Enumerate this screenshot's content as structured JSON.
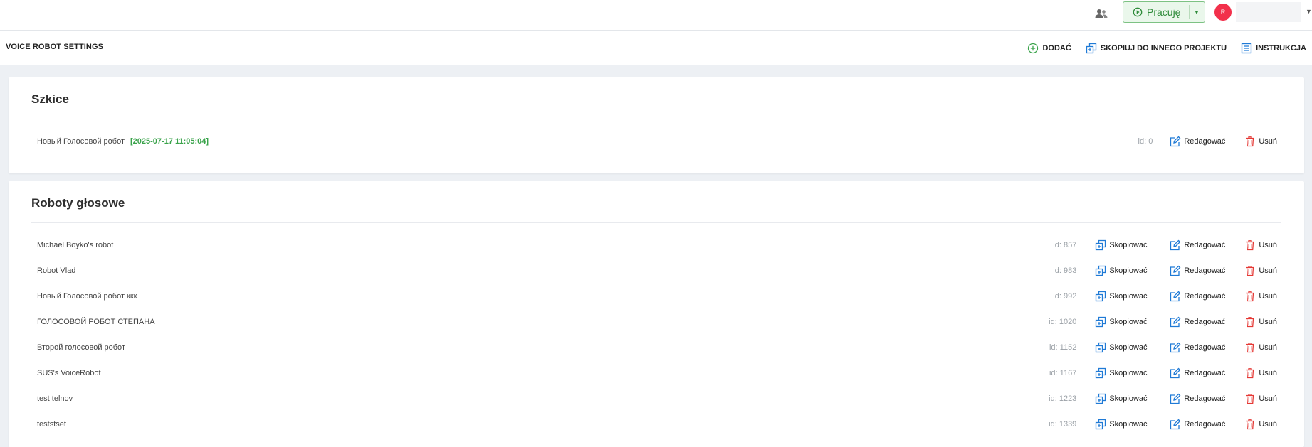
{
  "topbar": {
    "status_label": "Pracuję",
    "avatar_initial": "R",
    "user_name": ""
  },
  "header": {
    "title": "VOICE ROBOT SETTINGS",
    "actions": {
      "add": "DODAĆ",
      "copy_to_project": "SKOPIUJ DO INNEGO PROJEKTU",
      "instructions": "INSTRUKCJA"
    }
  },
  "drafts": {
    "title": "Szkice",
    "items": [
      {
        "name": "Новый Голосовой робот",
        "date": "[2025-07-17 11:05:04]",
        "id": "id: 0"
      }
    ]
  },
  "robots": {
    "title": "Roboty głosowe",
    "items": [
      {
        "name": "Michael Boyko's robot",
        "id": "id: 857"
      },
      {
        "name": "Robot Vlad",
        "id": "id: 983"
      },
      {
        "name": "Новый Голосовой робот ккк",
        "id": "id: 992"
      },
      {
        "name": "ГОЛОСОВОЙ РОБОТ СТЕПАНА",
        "id": "id: 1020"
      },
      {
        "name": "Второй голосовой робот",
        "id": "id: 1152"
      },
      {
        "name": "SUS's VoiceRobot",
        "id": "id: 1167"
      },
      {
        "name": "test telnov",
        "id": "id: 1223"
      },
      {
        "name": "teststset",
        "id": "id: 1339"
      }
    ]
  },
  "row_actions": {
    "copy": "Skopiować",
    "edit": "Redagować",
    "delete": "Usuń"
  },
  "colors": {
    "accent_green": "#3aa34b",
    "accent_blue": "#1f7ad6",
    "danger_red": "#e53935",
    "avatar_red": "#f2304b"
  },
  "icons": {
    "team": "team-icon",
    "status": "play-circle-icon",
    "add": "plus-circle-icon",
    "copy": "copy-icon",
    "instructions": "list-doc-icon",
    "edit": "edit-icon",
    "delete": "trash-icon"
  }
}
